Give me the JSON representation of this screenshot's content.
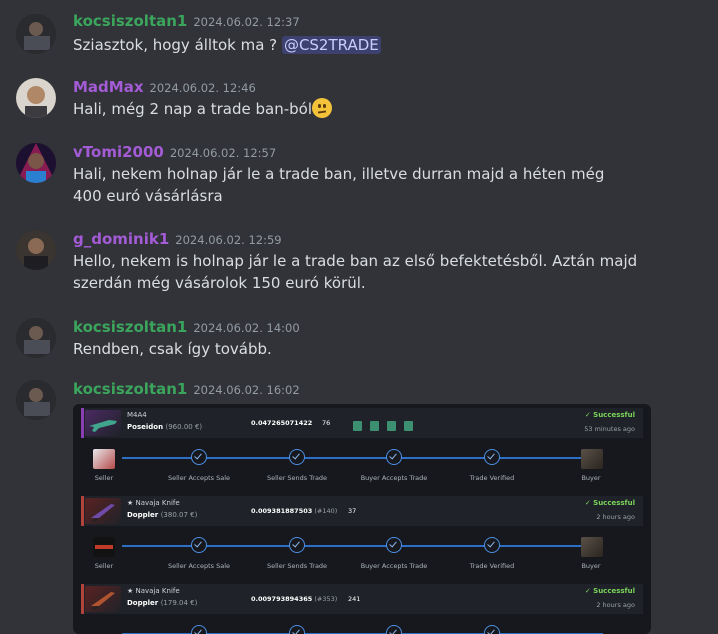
{
  "messages": [
    {
      "username": "kocsiszoltan1",
      "user_color": "#3ba55d",
      "timestamp": "2024.06.02. 12:37",
      "text": "Sziasztok, hogy álltok ma ?",
      "mention": "@CS2TRADE"
    },
    {
      "username": "MadMax",
      "user_color": "#a45bd6",
      "timestamp": "2024.06.02. 12:46",
      "text": "Hali, még 2 nap a trade ban-ból",
      "emoji": "confused-face"
    },
    {
      "username": "vTomi2000",
      "user_color": "#a45bd6",
      "timestamp": "2024.06.02. 12:57",
      "text": "Hali, nekem holnap jár le a trade ban, illetve durran majd a héten még 400 euró vásárlásra"
    },
    {
      "username": "g_dominik1",
      "user_color": "#a45bd6",
      "timestamp": "2024.06.02. 12:59",
      "text": "Hello, nekem is holnap jár le a trade ban az első befektetésből. Aztán majd szerdán még vásárolok 150 euró körül."
    },
    {
      "username": "kocsiszoltan1",
      "user_color": "#3ba55d",
      "timestamp": "2024.06.02. 14:00",
      "text": "Rendben, csak így tovább."
    },
    {
      "username": "kocsiszoltan1",
      "user_color": "#3ba55d",
      "timestamp": "2024.06.02. 16:02"
    }
  ],
  "trades": [
    {
      "weapon": "M4A4",
      "skin": "Poseidon",
      "price": "(960.00 €)",
      "float": "0.047265071422",
      "float_rank": "",
      "pattern": "76",
      "status": "Successful",
      "time": "53 minutes ago",
      "accent": "#8a3fb5",
      "stickers": 4
    },
    {
      "weapon": "★ Navaja Knife",
      "skin": "Doppler",
      "price": "(380.07 €)",
      "float": "0.009381887503",
      "float_rank": "(#140)",
      "pattern": "37",
      "status": "Successful",
      "time": "2 hours ago",
      "accent": "#b3443a",
      "stickers": 0
    },
    {
      "weapon": "★ Navaja Knife",
      "skin": "Doppler",
      "price": "(179.04 €)",
      "float": "0.009793894365",
      "float_rank": "(#353)",
      "pattern": "241",
      "status": "Successful",
      "time": "2 hours ago",
      "accent": "#b3443a",
      "stickers": 0
    }
  ],
  "steps": {
    "labels": [
      "Seller",
      "Seller Accepts Sale",
      "Seller Sends Trade",
      "Buyer Accepts Trade",
      "Trade Verified",
      "Buyer"
    ]
  },
  "colors": {
    "background": "#313338",
    "green_user": "#3ba55d",
    "purple_user": "#a45bd6",
    "success": "#7bd45a",
    "progress": "#2d6fc4"
  }
}
